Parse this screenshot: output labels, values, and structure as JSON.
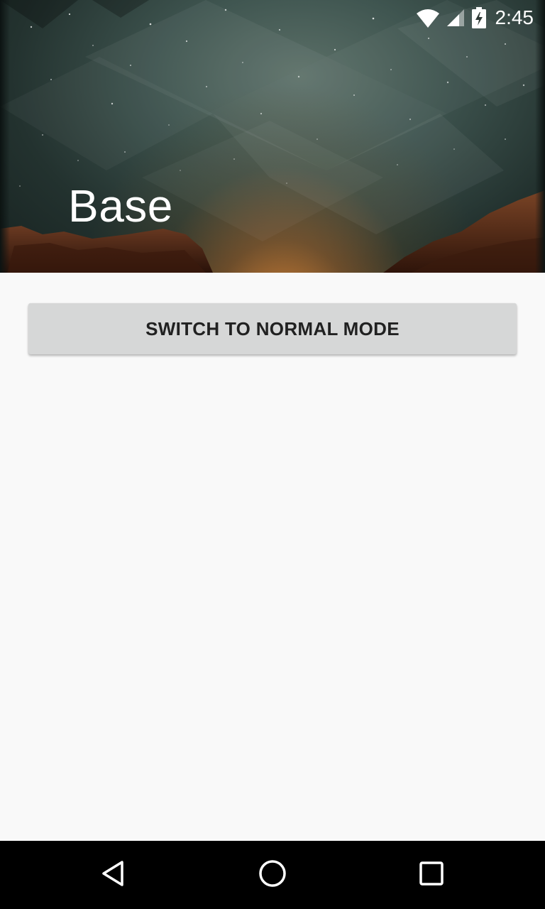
{
  "header": {
    "title": "Base"
  },
  "status_bar": {
    "time": "2:45",
    "icons": [
      "wifi-icon",
      "cell-signal-icon",
      "battery-charging-icon"
    ]
  },
  "main": {
    "button_label": "SWITCH TO NORMAL MODE"
  },
  "nav_bar": {
    "icons": [
      "back-icon",
      "home-icon",
      "recents-icon"
    ]
  },
  "colors": {
    "background": "#f9f9f9",
    "button": "#d6d7d7",
    "button_text": "#212121",
    "nav_bar": "#000000"
  }
}
